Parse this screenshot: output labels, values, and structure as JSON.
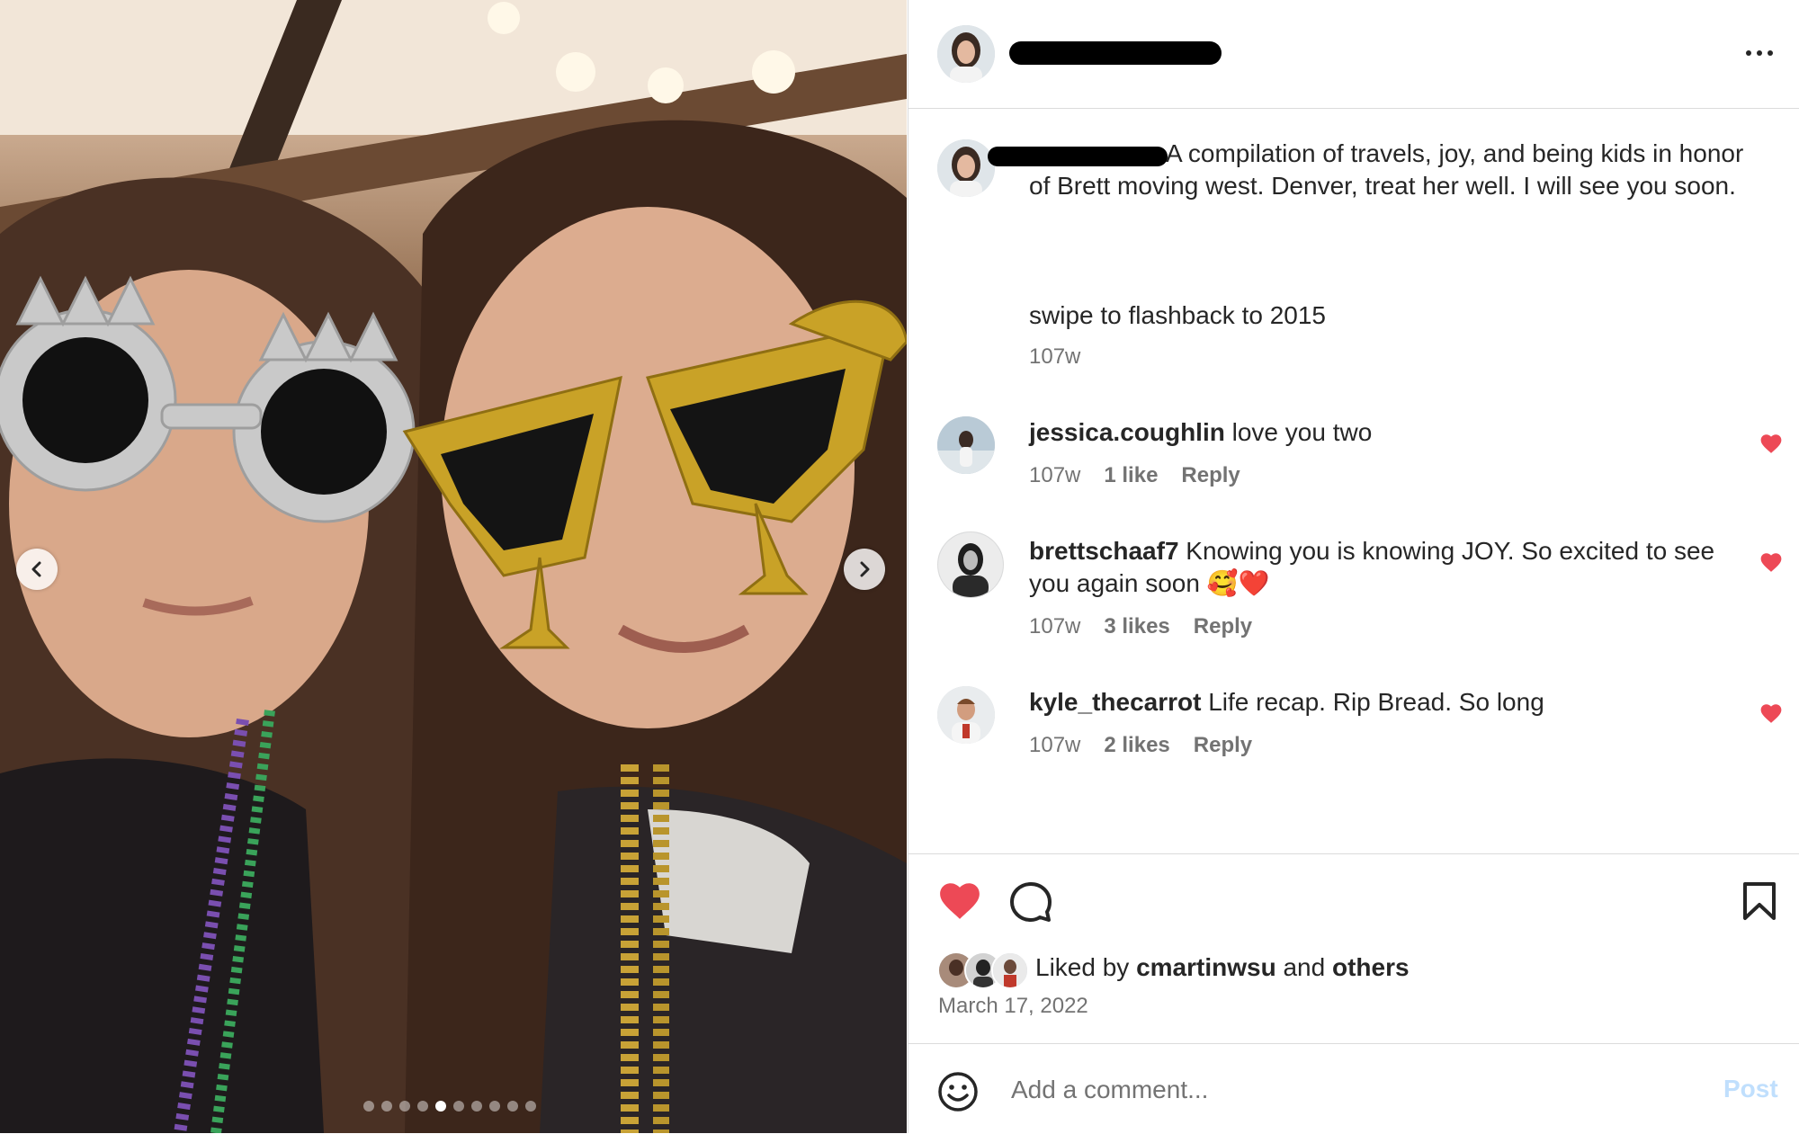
{
  "media": {
    "slides_total": 10,
    "active_slide_index": 4
  },
  "header": {
    "more_icon": "more-horizontal-icon"
  },
  "caption": {
    "text": "A compilation of travels, joy, and being kids in honor of Brett moving west. Denver, treat her well. I will see you soon.",
    "line2": "swipe to flashback to 2015",
    "time": "107w"
  },
  "comments": [
    {
      "user": "jessica.coughlin",
      "text": "love you two",
      "time": "107w",
      "likes": "1 like",
      "reply": "Reply"
    },
    {
      "user": "brettschaaf7",
      "text": "Knowing you is knowing JOY. So excited to see you again soon 🥰❤️",
      "time": "107w",
      "likes": "3 likes",
      "reply": "Reply"
    },
    {
      "user": "kyle_thecarrot",
      "text": "Life recap. Rip Bread. So long",
      "time": "107w",
      "likes": "2 likes",
      "reply": "Reply"
    }
  ],
  "actions": {
    "liked_prefix": "Liked by",
    "liked_user": "cmartinwsu",
    "liked_and": "and",
    "liked_others": "others",
    "date": "March 17, 2022"
  },
  "add_comment": {
    "placeholder": "Add a comment...",
    "post_label": "Post"
  },
  "colors": {
    "like_red": "#ed4956",
    "post_disabled": "#c0dffd",
    "border": "#dbdbdb"
  }
}
